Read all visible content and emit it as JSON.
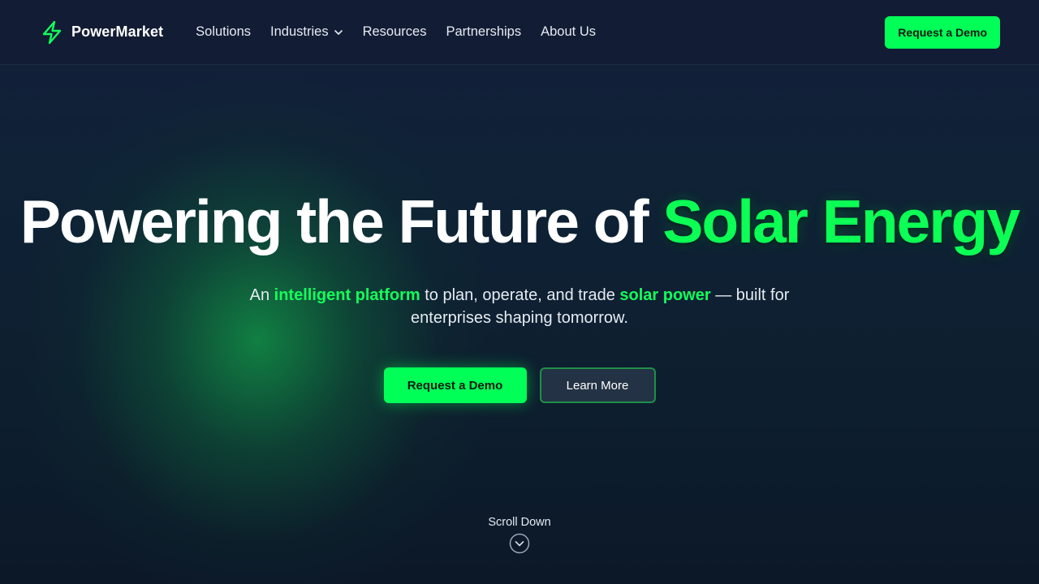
{
  "brand": {
    "name": "PowerMarket",
    "logo_icon": "lightning-bolt-icon",
    "accent": "#00ff57"
  },
  "nav": {
    "items": [
      {
        "label": "Solutions"
      },
      {
        "label": "Industries",
        "icon": "chevron-down-icon"
      },
      {
        "label": "Resources"
      },
      {
        "label": "Partnerships"
      },
      {
        "label": "About Us"
      }
    ],
    "cta_label": "Request a Demo"
  },
  "hero": {
    "headline_main": "Powering the Future of",
    "headline_accent": "Solar Energy",
    "subtitle": {
      "part1": "An ",
      "highlight1": "intelligent platform",
      "part2": " to plan, operate, and trade ",
      "highlight2": "solar power",
      "part3": " — built for enterprises shaping tomorrow."
    },
    "primary_button": "Request a Demo",
    "secondary_button": "Learn More",
    "scroll_label": "Scroll Down",
    "scroll_icon": "chevron-down-circle-icon"
  },
  "colors": {
    "background": "#0f1b2e",
    "accent_green": "#00ff57",
    "text": "#f1f5f9"
  }
}
